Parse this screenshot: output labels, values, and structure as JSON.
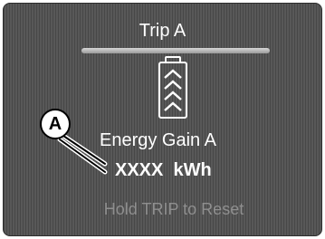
{
  "screen": {
    "title": "Trip A",
    "label": "Energy Gain A",
    "value": "XXXX  kWh",
    "hint": "Hold TRIP to Reset",
    "icon": "battery-charging-chevrons-icon"
  },
  "callout": {
    "letter": "A"
  },
  "colors": {
    "screen_background": "#4f4f4f",
    "text": "#ffffff",
    "hint_text": "#8f8f8f",
    "divider": "#c8c8c8"
  }
}
